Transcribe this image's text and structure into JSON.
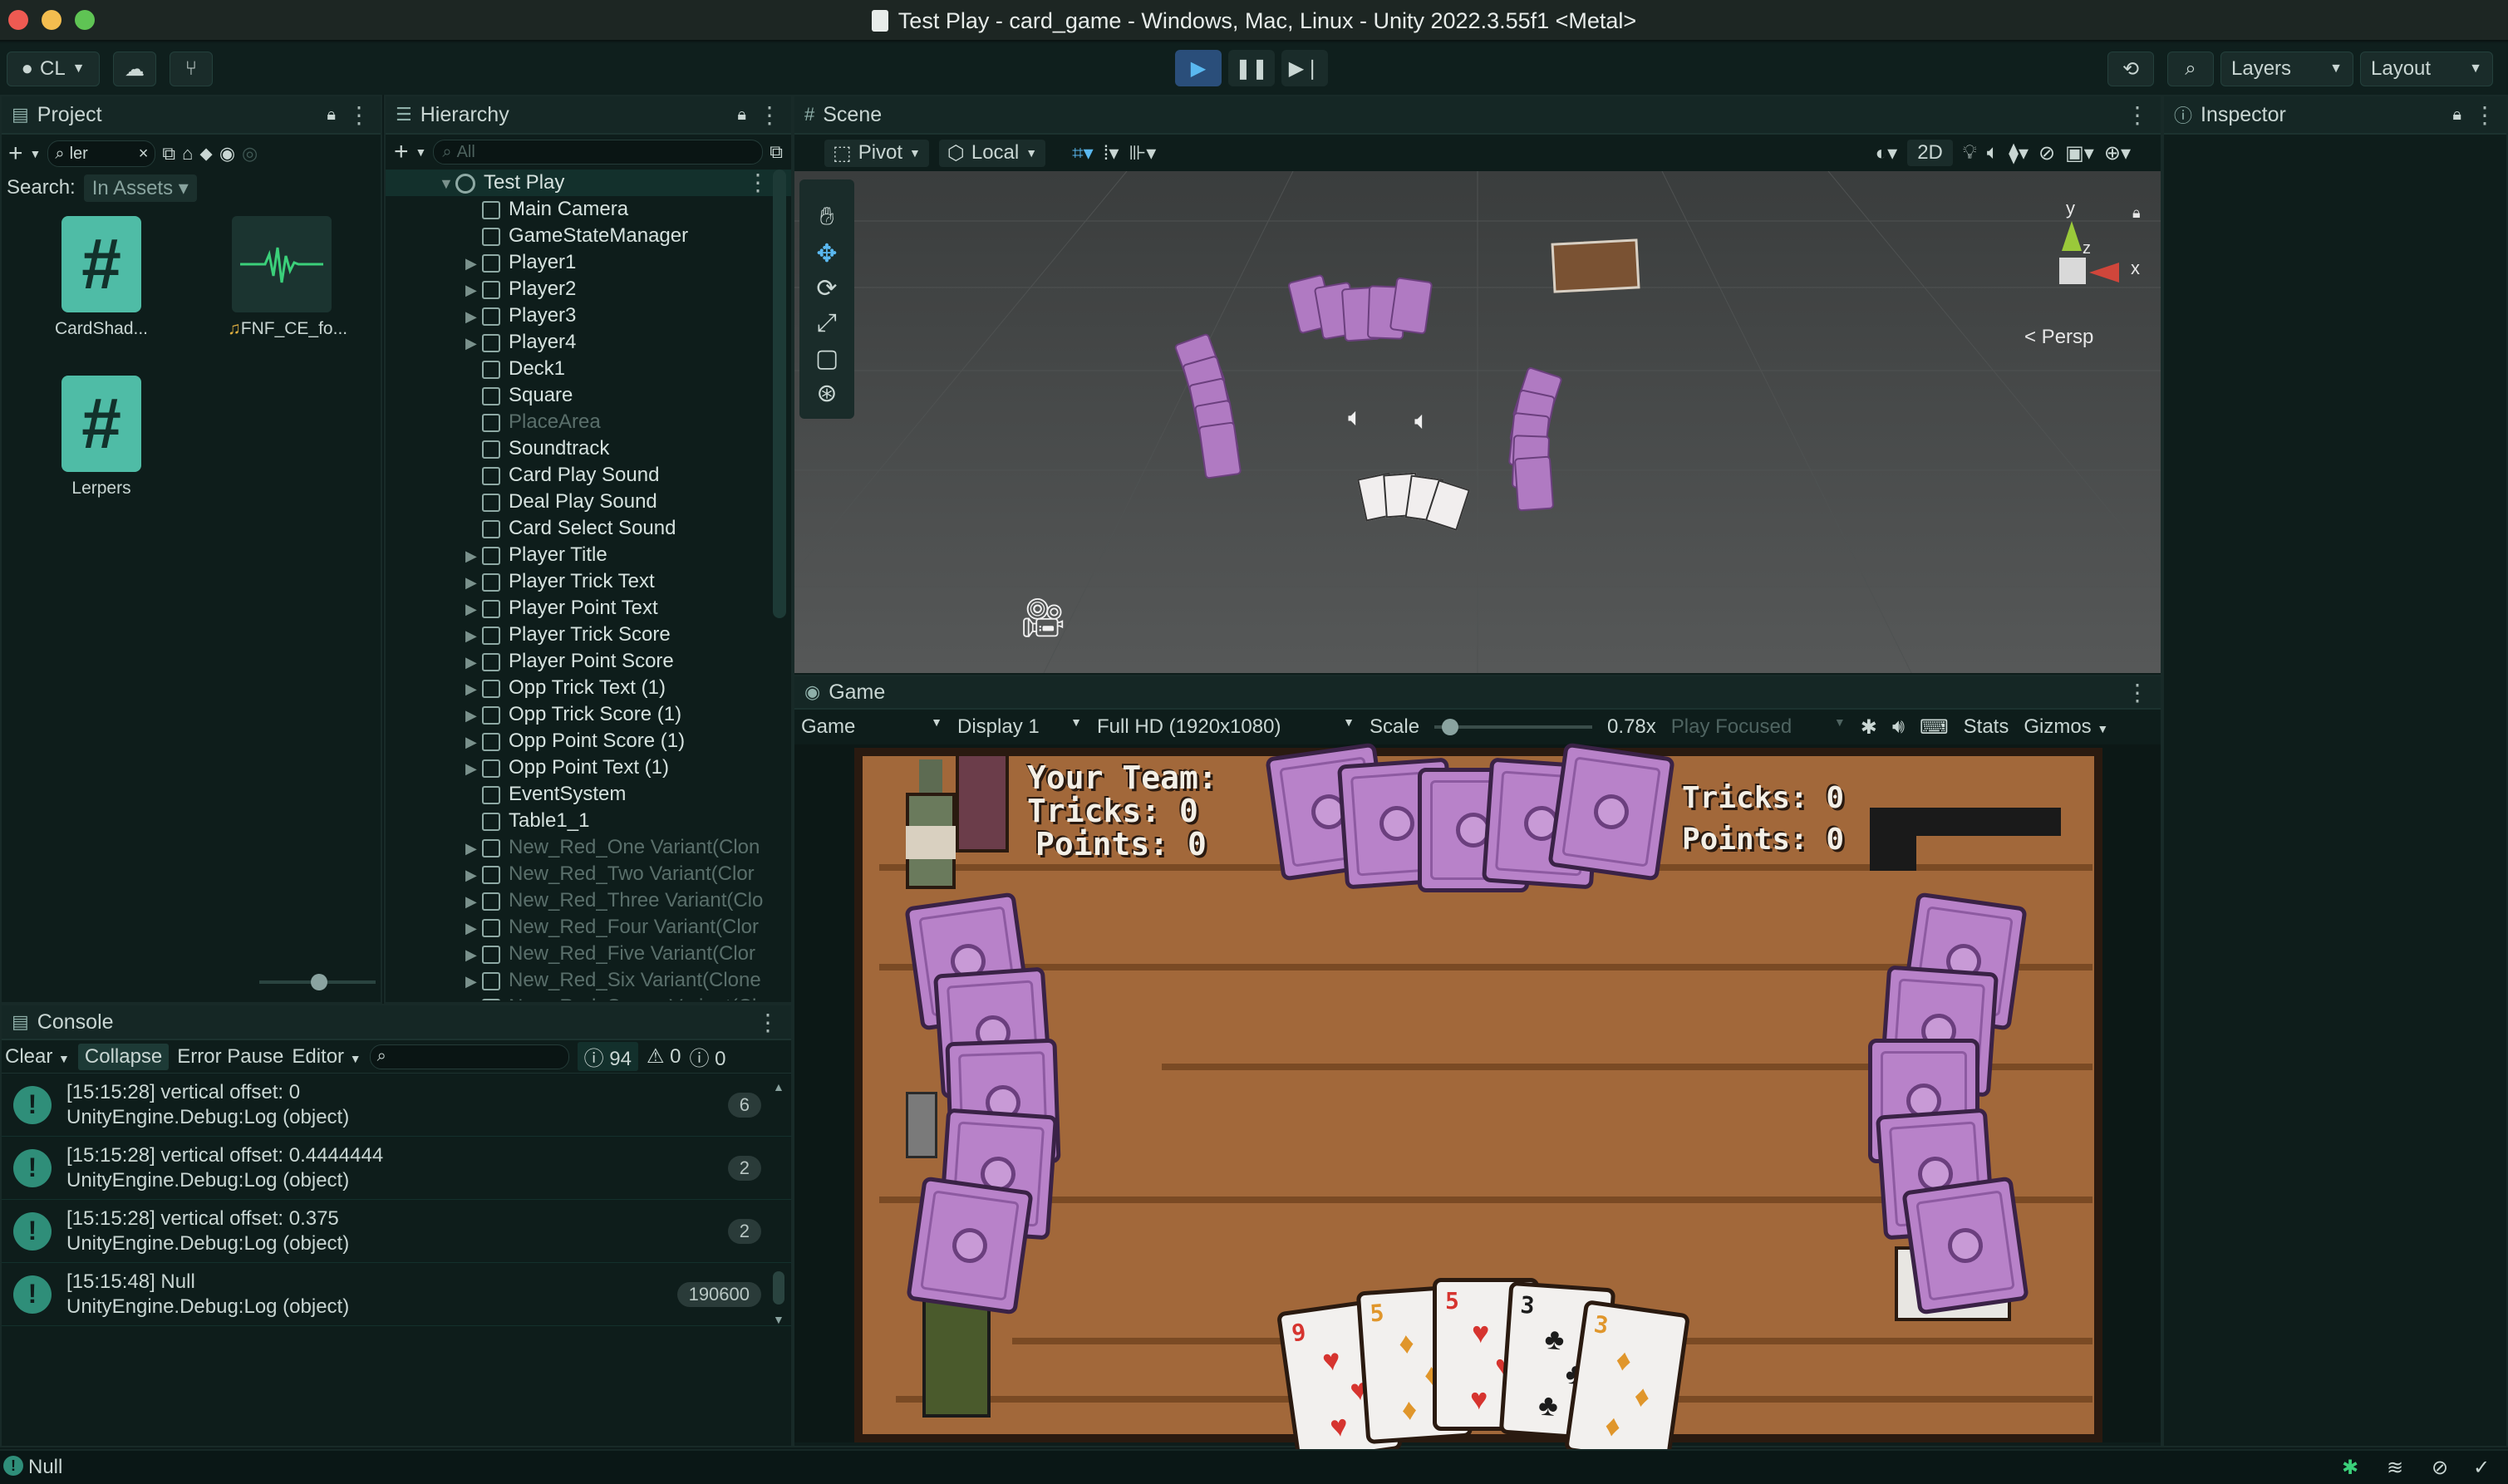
{
  "window": {
    "title": "Test Play - card_game - Windows, Mac, Linux - Unity 2022.3.55f1 <Metal>",
    "traffic_colors": [
      "#ee5a52",
      "#f4bd4f",
      "#5fc454"
    ]
  },
  "toolbar": {
    "account_label": "CL",
    "layers_label": "Layers",
    "layout_label": "Layout",
    "accent": "#2fa7d8"
  },
  "project": {
    "tab_label": "Project",
    "search_value": "ler",
    "search_label": "Search:",
    "search_scope": "In Assets",
    "assets": [
      {
        "name": "CardShad...",
        "icon": "csharp-script-icon"
      },
      {
        "name": "FNF_CE_fo...",
        "icon": "audio-clip-icon"
      },
      {
        "name": "Lerpers",
        "icon": "csharp-script-icon"
      }
    ]
  },
  "hierarchy": {
    "tab_label": "Hierarchy",
    "search_placeholder": "All",
    "root": "Test Play",
    "items": [
      {
        "label": "Main Camera",
        "arrow": false,
        "dim": false
      },
      {
        "label": "GameStateManager",
        "arrow": false,
        "dim": false
      },
      {
        "label": "Player1",
        "arrow": true,
        "dim": false
      },
      {
        "label": "Player2",
        "arrow": true,
        "dim": false
      },
      {
        "label": "Player3",
        "arrow": true,
        "dim": false
      },
      {
        "label": "Player4",
        "arrow": true,
        "dim": false
      },
      {
        "label": "Deck1",
        "arrow": false,
        "dim": false
      },
      {
        "label": "Square",
        "arrow": false,
        "dim": false
      },
      {
        "label": "PlaceArea",
        "arrow": false,
        "dim": true
      },
      {
        "label": "Soundtrack",
        "arrow": false,
        "dim": false
      },
      {
        "label": "Card Play Sound",
        "arrow": false,
        "dim": false
      },
      {
        "label": "Deal Play Sound",
        "arrow": false,
        "dim": false
      },
      {
        "label": "Card Select Sound",
        "arrow": false,
        "dim": false
      },
      {
        "label": "Player Title",
        "arrow": true,
        "dim": false
      },
      {
        "label": "Player Trick Text",
        "arrow": true,
        "dim": false
      },
      {
        "label": "Player Point Text",
        "arrow": true,
        "dim": false
      },
      {
        "label": "Player Trick Score",
        "arrow": true,
        "dim": false
      },
      {
        "label": "Player Point Score",
        "arrow": true,
        "dim": false
      },
      {
        "label": "Opp Trick Text (1)",
        "arrow": true,
        "dim": false
      },
      {
        "label": "Opp Trick Score (1)",
        "arrow": true,
        "dim": false
      },
      {
        "label": "Opp Point Score (1)",
        "arrow": true,
        "dim": false
      },
      {
        "label": "Opp Point Text (1)",
        "arrow": true,
        "dim": false
      },
      {
        "label": "EventSystem",
        "arrow": false,
        "dim": false
      },
      {
        "label": "Table1_1",
        "arrow": false,
        "dim": false
      },
      {
        "label": "New_Red_One Variant(Clon",
        "arrow": true,
        "dim": true
      },
      {
        "label": "New_Red_Two Variant(Clor",
        "arrow": true,
        "dim": true
      },
      {
        "label": "New_Red_Three Variant(Clo",
        "arrow": true,
        "dim": true
      },
      {
        "label": "New_Red_Four Variant(Clor",
        "arrow": true,
        "dim": true
      },
      {
        "label": "New_Red_Five Variant(Clor",
        "arrow": true,
        "dim": true
      },
      {
        "label": "New_Red_Six Variant(Clone",
        "arrow": true,
        "dim": true
      },
      {
        "label": "New_Red_Seven Variant(Cl",
        "arrow": true,
        "dim": true
      }
    ]
  },
  "scene": {
    "tab_label": "Scene",
    "pivot_label": "Pivot",
    "local_label": "Local",
    "twod_label": "2D",
    "persp_label": "< Persp",
    "axis_y": "y",
    "axis_z": "z",
    "axis_x": "x"
  },
  "game": {
    "tab_label": "Game",
    "mode_label": "Game",
    "display_label": "Display 1",
    "resolution_label": "Full HD (1920x1080)",
    "scale_label": "Scale",
    "scale_value": "0.78x",
    "scale_fraction": 0.05,
    "play_focused_label": "Play Focused",
    "stats_label": "Stats",
    "gizmos_label": "Gizmos",
    "your_team": "Your Team:",
    "tricks_left": "Tricks: 0",
    "points_left": "Points: 0",
    "tricks_right": "Tricks: 0",
    "points_right": "Points: 0",
    "hand": [
      {
        "rank": "9",
        "suit": "♥",
        "color": "#d6342f"
      },
      {
        "rank": "5",
        "suit": "♦",
        "color": "#e0962b"
      },
      {
        "rank": "5",
        "suit": "♥",
        "color": "#d6342f"
      },
      {
        "rank": "3",
        "suit": "♣",
        "color": "#1c1c1c"
      },
      {
        "rank": "3",
        "suit": "♦",
        "color": "#e0962b"
      }
    ]
  },
  "inspector": {
    "tab_label": "Inspector"
  },
  "console": {
    "tab_label": "Console",
    "clear_label": "Clear",
    "collapse_label": "Collapse",
    "error_pause_label": "Error Pause",
    "editor_label": "Editor",
    "info_count": "94",
    "warn_count": "0",
    "error_count": "0",
    "entries": [
      {
        "line1": "[15:15:28] vertical offset: 0",
        "line2": "UnityEngine.Debug:Log (object)",
        "count": "6"
      },
      {
        "line1": "[15:15:28] vertical offset: 0.4444444",
        "line2": "UnityEngine.Debug:Log (object)",
        "count": "2"
      },
      {
        "line1": "[15:15:28] vertical offset: 0.375",
        "line2": "UnityEngine.Debug:Log (object)",
        "count": "2"
      },
      {
        "line1": "[15:15:48] Null",
        "line2": "UnityEngine.Debug:Log (object)",
        "count": "190600"
      }
    ]
  },
  "status": {
    "message": "Null"
  }
}
